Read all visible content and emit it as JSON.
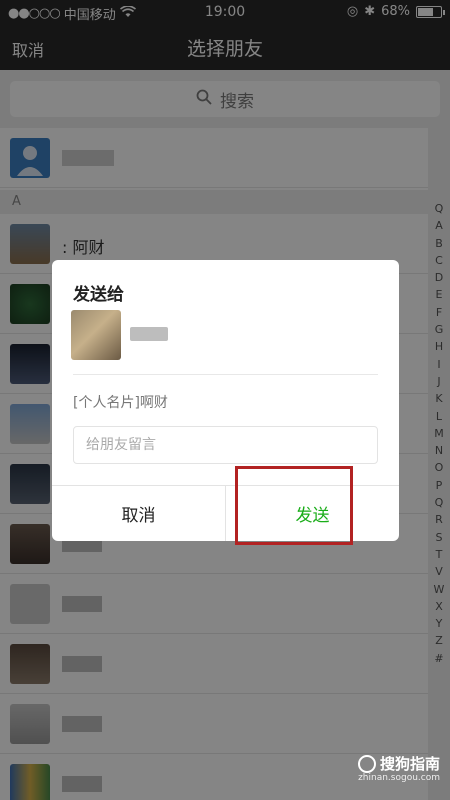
{
  "status_bar": {
    "carrier": "中国移动",
    "time": "19:00",
    "battery": "68%",
    "battery_level": 0.68
  },
  "nav": {
    "cancel": "取消",
    "title": "选择朋友"
  },
  "search": {
    "placeholder": "搜索"
  },
  "list": {
    "section_a": "A",
    "row_names": [
      "",
      ": 阿财",
      "",
      "",
      "",
      "",
      "",
      "",
      "",
      "",
      ""
    ]
  },
  "index_letters": [
    "Q",
    "A",
    "B",
    "C",
    "D",
    "E",
    "F",
    "G",
    "H",
    "I",
    "J",
    "K",
    "L",
    "M",
    "N",
    "O",
    "P",
    "Q",
    "R",
    "S",
    "T",
    "V",
    "W",
    "X",
    "Y",
    "Z",
    "#"
  ],
  "dialog": {
    "title": "发送给",
    "card_text": "[个人名片]啊财",
    "message_placeholder": "给朋友留言",
    "cancel": "取消",
    "send": "发送",
    "send_color": "#1aad19"
  },
  "watermark": {
    "main": "搜狗指南",
    "sub": "zhinan.sogou.com"
  },
  "colors": {
    "nav_bg": "#2a2a2a",
    "highlight": "#b22222",
    "accent_green": "#1aad19"
  }
}
